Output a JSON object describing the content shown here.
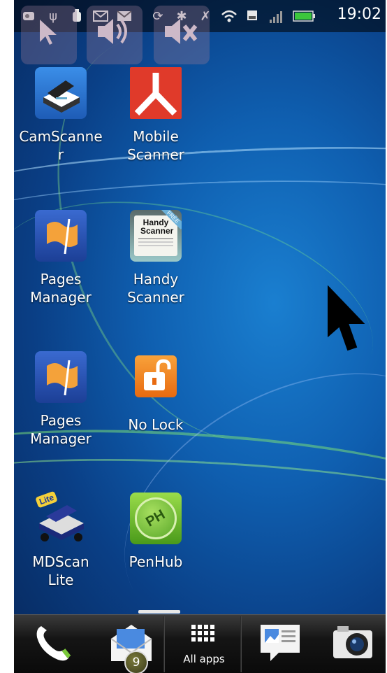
{
  "status_bar": {
    "time": "19:02",
    "icons": [
      "notification-icon",
      "usb-icon",
      "debug-icon",
      "gmail-icon",
      "email-icon",
      "sync-icon",
      "bluetooth-icon",
      "no-signal-icon",
      "wifi-icon",
      "sd-card-icon",
      "cellular-icon",
      "battery-icon"
    ],
    "battery_color": "#3cc63c"
  },
  "quick_buttons": [
    {
      "name": "pointer-quick-button",
      "icon": "arrow-pointer-icon"
    },
    {
      "name": "volume-up-quick-button",
      "icon": "speaker-icon"
    },
    {
      "name": "mute-quick-button",
      "icon": "mute-icon"
    }
  ],
  "apps": [
    {
      "label": "CamScanne\nr",
      "icon": "camscanner-icon",
      "color": "#2a6ec8"
    },
    {
      "label": "Mobile\nScanner",
      "icon": "mobile-scanner-icon",
      "color": "#e03a2a"
    },
    {
      "label": "Pages\nManager",
      "icon": "pages-manager-icon",
      "color": "#2a5ab8"
    },
    {
      "label": "Handy\nScanner",
      "icon": "handy-scanner-icon",
      "color": "#8ab8b8",
      "icon_text": "Handy Scanner",
      "icon_tag": "FREE"
    },
    {
      "label": "Pages\nManager",
      "icon": "pages-manager-icon",
      "color": "#2a5ab8"
    },
    {
      "label": "No Lock",
      "icon": "no-lock-icon",
      "color": "#f08a1a"
    },
    {
      "label": "MDScan\nLite",
      "icon": "mdscan-lite-icon",
      "color": "#1a3a9a",
      "icon_tag": "Lite"
    },
    {
      "label": "PenHub",
      "icon": "penhub-icon",
      "color": "#7ac83a",
      "icon_text": "PH"
    }
  ],
  "dock": {
    "phone_icon": "phone-icon",
    "mail_icon": "mail-icon",
    "mail_badge": "9",
    "all_apps_label": "All apps",
    "messages_icon": "messages-icon",
    "camera_icon": "camera-icon"
  }
}
